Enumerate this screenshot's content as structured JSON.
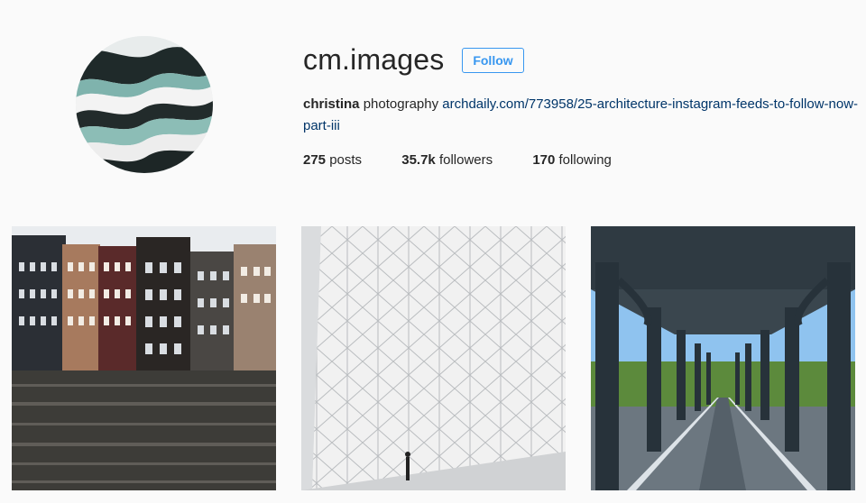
{
  "profile": {
    "username": "cm.images",
    "follow_label": "Follow",
    "bio_name": "christina",
    "bio_text": "photography",
    "bio_link": "archdaily.com/773958/25-architecture-instagram-feeds-to-follow-now-part-iii"
  },
  "stats": {
    "posts_count": "275",
    "posts_label": "posts",
    "followers_count": "35.7k",
    "followers_label": "followers",
    "following_count": "170",
    "following_label": "following"
  },
  "posts": [
    {
      "subject": "canal-houses-photo"
    },
    {
      "subject": "geometric-facade-photo"
    },
    {
      "subject": "bridge-colonnade-photo"
    }
  ],
  "colors": {
    "accent": "#3897f0",
    "link": "#003569",
    "text": "#262626",
    "background": "#fafafa"
  }
}
